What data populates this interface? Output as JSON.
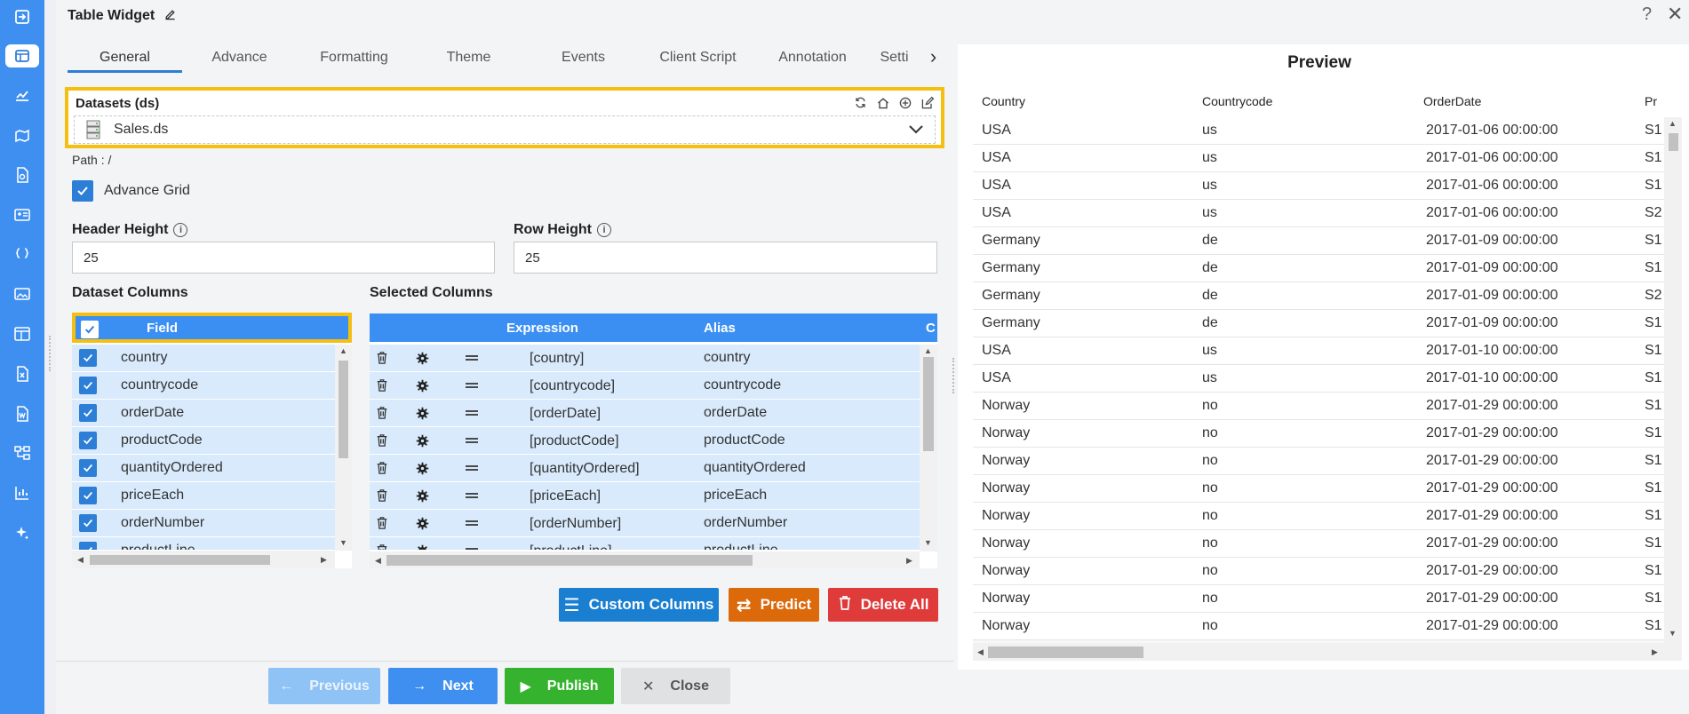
{
  "window": {
    "title": "Table Widget",
    "help": "?",
    "close": "✕"
  },
  "tabs": [
    "General",
    "Advance",
    "Formatting",
    "Theme",
    "Events",
    "Client Script",
    "Annotation",
    "Setti"
  ],
  "datasets": {
    "label": "Datasets (ds)",
    "value": "Sales.ds"
  },
  "path": "Path : /",
  "advance_grid": {
    "label": "Advance Grid",
    "checked": true
  },
  "header_height": {
    "label": "Header Height",
    "value": "25"
  },
  "row_height": {
    "label": "Row Height",
    "value": "25"
  },
  "dataset_columns": {
    "title": "Dataset Columns",
    "header": "Field",
    "rows": [
      "country",
      "countrycode",
      "orderDate",
      "productCode",
      "quantityOrdered",
      "priceEach",
      "orderNumber",
      "productLine"
    ]
  },
  "selected_columns": {
    "title": "Selected Columns",
    "headers": {
      "expression": "Expression",
      "alias": "Alias",
      "extra": "C"
    },
    "rows": [
      {
        "expression": "[country]",
        "alias": "country"
      },
      {
        "expression": "[countrycode]",
        "alias": "countrycode"
      },
      {
        "expression": "[orderDate]",
        "alias": "orderDate"
      },
      {
        "expression": "[productCode]",
        "alias": "productCode"
      },
      {
        "expression": "[quantityOrdered]",
        "alias": "quantityOrdered"
      },
      {
        "expression": "[priceEach]",
        "alias": "priceEach"
      },
      {
        "expression": "[orderNumber]",
        "alias": "orderNumber"
      },
      {
        "expression": "[productLine]",
        "alias": "productLine"
      }
    ]
  },
  "actions": {
    "custom_columns": "Custom Columns",
    "predict": "Predict",
    "delete_all": "Delete All"
  },
  "nav": {
    "previous": "Previous",
    "next": "Next",
    "publish": "Publish",
    "close": "Close"
  },
  "preview": {
    "title": "Preview",
    "headers": [
      "Country",
      "Countrycode",
      "OrderDate",
      "Pr"
    ],
    "rows": [
      [
        "USA",
        "us",
        "2017-01-06 00:00:00",
        "S1"
      ],
      [
        "USA",
        "us",
        "2017-01-06 00:00:00",
        "S1"
      ],
      [
        "USA",
        "us",
        "2017-01-06 00:00:00",
        "S1"
      ],
      [
        "USA",
        "us",
        "2017-01-06 00:00:00",
        "S2"
      ],
      [
        "Germany",
        "de",
        "2017-01-09 00:00:00",
        "S1"
      ],
      [
        "Germany",
        "de",
        "2017-01-09 00:00:00",
        "S1"
      ],
      [
        "Germany",
        "de",
        "2017-01-09 00:00:00",
        "S2"
      ],
      [
        "Germany",
        "de",
        "2017-01-09 00:00:00",
        "S1"
      ],
      [
        "USA",
        "us",
        "2017-01-10 00:00:00",
        "S1"
      ],
      [
        "USA",
        "us",
        "2017-01-10 00:00:00",
        "S1"
      ],
      [
        "Norway",
        "no",
        "2017-01-29 00:00:00",
        "S1"
      ],
      [
        "Norway",
        "no",
        "2017-01-29 00:00:00",
        "S1"
      ],
      [
        "Norway",
        "no",
        "2017-01-29 00:00:00",
        "S1"
      ],
      [
        "Norway",
        "no",
        "2017-01-29 00:00:00",
        "S1"
      ],
      [
        "Norway",
        "no",
        "2017-01-29 00:00:00",
        "S1"
      ],
      [
        "Norway",
        "no",
        "2017-01-29 00:00:00",
        "S1"
      ],
      [
        "Norway",
        "no",
        "2017-01-29 00:00:00",
        "S1"
      ],
      [
        "Norway",
        "no",
        "2017-01-29 00:00:00",
        "S1"
      ],
      [
        "Norway",
        "no",
        "2017-01-29 00:00:00",
        "S1"
      ]
    ]
  },
  "colors": {
    "rail": "#3f8ff0",
    "accent": "#2d7ed6",
    "highlight": "#f5bf12",
    "custom_columns": "#1a7fd0",
    "predict": "#dc6a0b",
    "delete_all": "#df3b3b",
    "publish": "#35b32e"
  },
  "rail_icons": [
    "sign-in-icon",
    "table-widget-icon",
    "chart-icon",
    "map-icon",
    "report-icon",
    "card-icon",
    "script-icon",
    "image-icon",
    "dashboard-icon",
    "excel-icon",
    "word-icon",
    "tree-icon",
    "analytics-icon",
    "ai-sparkle-icon"
  ]
}
